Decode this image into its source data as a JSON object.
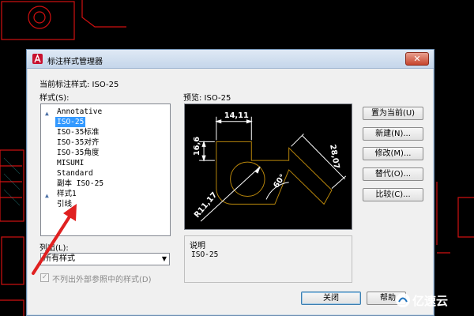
{
  "dialog": {
    "title": "标注样式管理器",
    "current_style_label": "当前标注样式: ISO-25",
    "styles_label": "样式(S):",
    "preview_label": "预览: ISO-25",
    "close_glyph": "✕"
  },
  "styles": [
    {
      "name": "Annotative",
      "annotative": true,
      "selected": false
    },
    {
      "name": "ISO-25",
      "annotative": false,
      "selected": true
    },
    {
      "name": "ISO-35标准",
      "annotative": false,
      "selected": false
    },
    {
      "name": "ISO-35对齐",
      "annotative": false,
      "selected": false
    },
    {
      "name": "ISO-35角度",
      "annotative": false,
      "selected": false
    },
    {
      "name": "MISUMI",
      "annotative": false,
      "selected": false
    },
    {
      "name": "Standard",
      "annotative": false,
      "selected": false
    },
    {
      "name": "副本 ISO-25",
      "annotative": false,
      "selected": false
    },
    {
      "name": "样式1",
      "annotative": true,
      "selected": false
    },
    {
      "name": "引线",
      "annotative": false,
      "selected": false
    }
  ],
  "list_filter": {
    "label": "列出(L):",
    "value": "所有样式"
  },
  "exclude_xref": {
    "label": "不列出外部参照中的样式(D)",
    "checked": true,
    "disabled": true
  },
  "preview": {
    "dims": [
      "14,11",
      "16,6",
      "28,07",
      "60°",
      "R11,17"
    ]
  },
  "description": {
    "title": "说明",
    "text": "ISO-25"
  },
  "buttons": {
    "set_current": "置为当前(U)",
    "new": "新建(N)...",
    "modify": "修改(M)...",
    "override": "替代(O)...",
    "compare": "比较(C)...",
    "close": "关闭",
    "help": "帮助"
  },
  "watermark": {
    "text": "亿速云"
  },
  "colors": {
    "selection": "#3399ff",
    "cad_line": "#d01010",
    "dim_white": "#ffffff",
    "preview_outline": "#b8860b"
  }
}
